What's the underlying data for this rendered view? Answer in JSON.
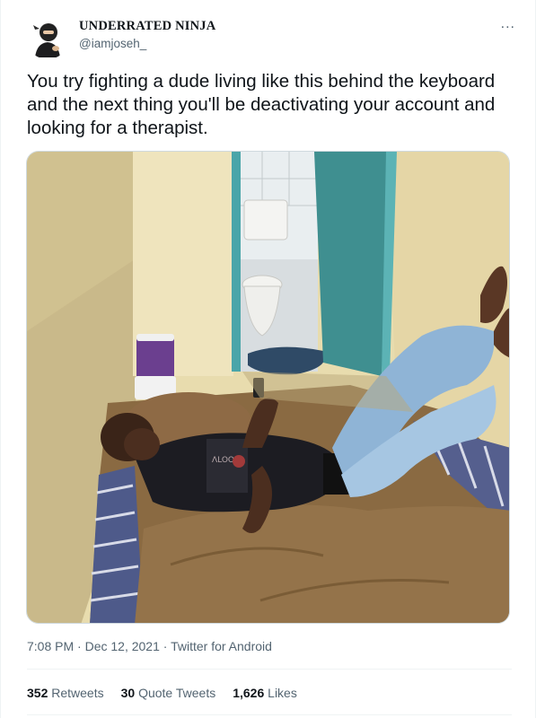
{
  "author": {
    "display_name": "UNDERRATED NINJA",
    "handle": "@iamjoseh_",
    "avatar_icon": "ninja-avatar-icon"
  },
  "more_icon": "...",
  "tweet": {
    "text": "You try fighting a dude living like this behind the keyboard and the next thing you'll be deactivating your account and looking for a therapist.",
    "time": "7:08 PM",
    "separator": "·",
    "date": "Dec 12, 2021",
    "source": "Twitter for Android"
  },
  "stats": {
    "retweets_count": "352",
    "retweets_label": "Retweets",
    "quotes_count": "30",
    "quotes_label": "Quote Tweets",
    "likes_count": "1,626",
    "likes_label": "Likes"
  },
  "colors": {
    "text": "#0f1419",
    "secondary": "#536471",
    "border": "#eff3f4"
  }
}
